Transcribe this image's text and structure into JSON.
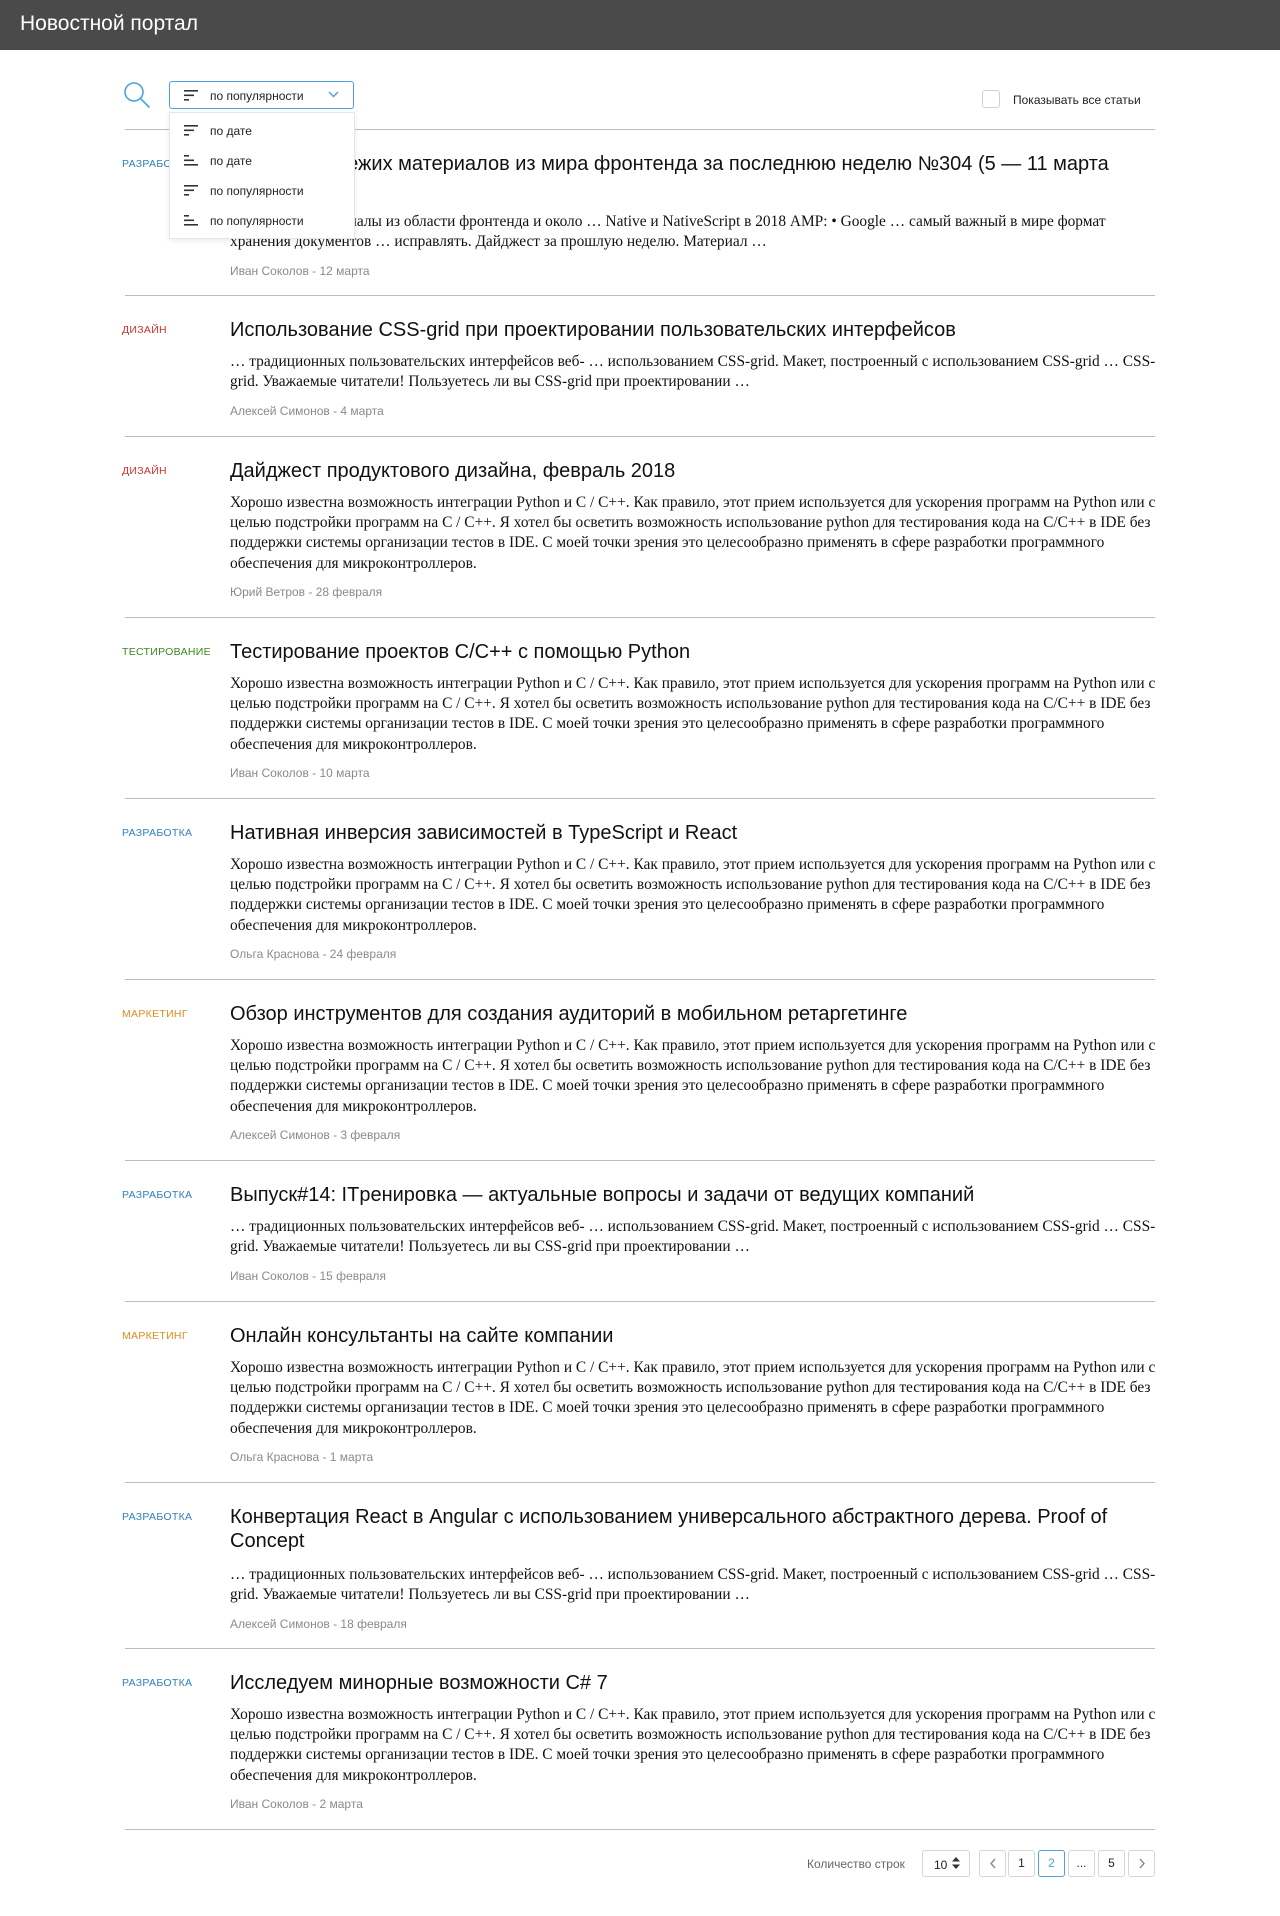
{
  "header": {
    "title": "Новостной портал"
  },
  "toolbar": {
    "search_icon": "search-icon",
    "sort_selected": "по популярности",
    "sort_options": [
      "по дате",
      "по дате",
      "по популярности",
      "по популярности"
    ],
    "show_all_label": "Показывать все статьи",
    "show_all_checked": false
  },
  "colors": {
    "topbar": "#4a4a4a",
    "accent": "#4aa3d9",
    "cat_development": "#2f7fc1",
    "cat_design": "#d0312d",
    "cat_testing": "#3a8a1f",
    "cat_marketing": "#e08a1e"
  },
  "articles": [
    {
      "category": "РАЗРАБОТКА",
      "title": "Дайджест свежих материалов из мира фронтенда за последнюю неделю №304 (5 — 11 марта 2018)",
      "excerpt": "Предлагаем материалы из области фронтенда и около … Native и NativeScript в 2018 AMP: • Google … самый важный в мире формат хранения документов … исправлять. Дайджест за прошлую неделю. Материал …",
      "meta": "Иван Соколов - 12 марта"
    },
    {
      "category": "ДИЗАЙН",
      "title": "Использование CSS-grid при проектировании пользовательских интерфейсов",
      "excerpt": "… традиционных пользовательских интерфейсов веб- … использованием CSS-grid. Макет, построенный с использованием CSS-grid … CSS-grid. Уважаемые читатели! Пользуетесь ли вы CSS-grid при проектировании …",
      "meta": "Алексей Симонов - 4 марта"
    },
    {
      "category": "ДИЗАЙН",
      "title": "Дайджест продуктового дизайна, февраль 2018",
      "excerpt": "Хорошо известна возможность интеграции Python и C / C++. Как правило, этот прием используется для ускорения программ на Python или с целью подстройки программ на C / C++. Я хотел бы осветить возможность использование python для тестирования кода на C/C++ в IDE без поддержки системы организации тестов в IDE. С моей точки зрения это целесообразно применять в сфере разработки программного обеспечения для микроконтроллеров.",
      "meta": "Юрий Ветров - 28 февраля"
    },
    {
      "category": "ТЕСТИРОВАНИЕ",
      "title": "Тестирование проектов C/C++ с помощью Python",
      "excerpt": "Хорошо известна возможность интеграции Python и C / C++. Как правило, этот прием используется для ускорения программ на Python или с целью подстройки программ на C / C++. Я хотел бы осветить возможность использование python для тестирования кода на C/C++ в IDE без поддержки системы организации тестов в IDE. С моей точки зрения это целесообразно применять в сфере разработки программного обеспечения для микроконтроллеров.",
      "meta": "Иван Соколов - 10 марта"
    },
    {
      "category": "РАЗРАБОТКА",
      "title": "Нативная инверсия зависимостей в TypeScript и React",
      "excerpt": "Хорошо известна возможность интеграции Python и C / C++. Как правило, этот прием используется для ускорения программ на Python или с целью подстройки программ на C / C++. Я хотел бы осветить возможность использование python для тестирования кода на C/C++ в IDE без поддержки системы организации тестов в IDE. С моей точки зрения это целесообразно применять в сфере разработки программного обеспечения для микроконтроллеров.",
      "meta": "Ольга Краснова - 24 февраля"
    },
    {
      "category": "МАРКЕТИНГ",
      "title": "Обзор инструментов для создания аудиторий в мобильном ретаргетинге",
      "excerpt": "Хорошо известна возможность интеграции Python и C / C++. Как правило, этот прием используется для ускорения программ на Python или с целью подстройки программ на C / C++. Я хотел бы осветить возможность использование python для тестирования кода на C/C++ в IDE без поддержки системы организации тестов в IDE. С моей точки зрения это целесообразно применять в сфере разработки программного обеспечения для микроконтроллеров.",
      "meta": "Алексей Симонов - 3 февраля"
    },
    {
      "category": "РАЗРАБОТКА",
      "title": "Выпуск#14: ITренировка — актуальные вопросы и задачи от ведущих компаний",
      "excerpt": "… традиционных пользовательских интерфейсов веб- … использованием CSS-grid. Макет, построенный с использованием CSS-grid … CSS-grid. Уважаемые читатели! Пользуетесь ли вы CSS-grid при проектировании …",
      "meta": "Иван Соколов - 15 февраля"
    },
    {
      "category": "МАРКЕТИНГ",
      "title": "Онлайн консультанты на сайте компании",
      "excerpt": "Хорошо известна возможность интеграции Python и C / C++. Как правило, этот прием используется для ускорения программ на Python или с целью подстройки программ на C / C++. Я хотел бы осветить возможность использование python для тестирования кода на C/C++ в IDE без поддержки системы организации тестов в IDE. С моей точки зрения это целесообразно применять в сфере разработки программного обеспечения для микроконтроллеров.",
      "meta": "Ольга Краснова - 1 марта"
    },
    {
      "category": "РАЗРАБОТКА",
      "title": "Конвертация React в Angular с использованием универсального абстрактного дерева. Proof of Concept",
      "excerpt": "… традиционных пользовательских интерфейсов веб- … использованием CSS-grid. Макет, построенный с использованием CSS-grid … CSS-grid. Уважаемые читатели! Пользуетесь ли вы CSS-grid при проектировании …",
      "meta": "Алексей Симонов - 18 февраля"
    },
    {
      "category": "РАЗРАБОТКА",
      "title": "Исследуем минорные возможности C# 7",
      "excerpt": "Хорошо известна возможность интеграции Python и C / C++. Как правило, этот прием используется для ускорения программ на Python или с целью подстройки программ на C / C++. Я хотел бы осветить возможность использование python для тестирования кода на C/C++ в IDE без поддержки системы организации тестов в IDE. С моей точки зрения это целесообразно применять в сфере разработки программного обеспечения для микроконтроллеров.",
      "meta": "Иван Соколов - 2 марта"
    }
  ],
  "pagination": {
    "rows_label": "Количество строк",
    "rows_value": "10",
    "pages": [
      "1",
      "2",
      "...",
      "5"
    ],
    "current_page": "2"
  }
}
